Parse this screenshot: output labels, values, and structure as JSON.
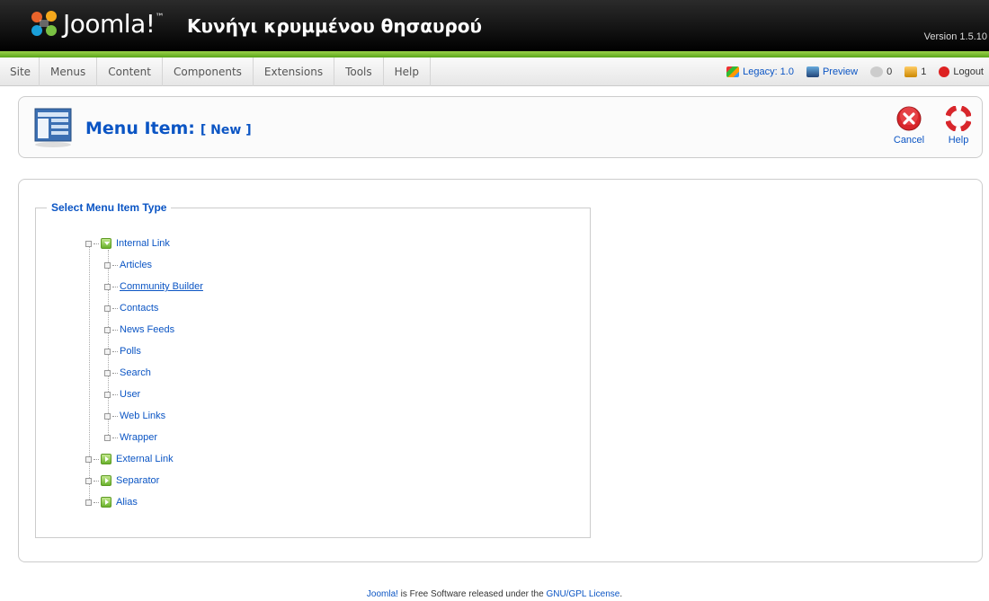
{
  "header": {
    "brand": "Joomla!",
    "brand_tm": "™",
    "site_name": "Κυνήγι κρυμμένου θησαυρού",
    "version": "Version 1.5.10"
  },
  "menu": [
    "Site",
    "Menus",
    "Content",
    "Components",
    "Extensions",
    "Tools",
    "Help"
  ],
  "status": {
    "legacy": "Legacy: 1.0",
    "preview": "Preview",
    "messages": "0",
    "users": "1",
    "logout": "Logout"
  },
  "toolbar": {
    "title": "Menu Item:",
    "subtitle": "[ New ]",
    "cancel": "Cancel",
    "help": "Help"
  },
  "fieldset": {
    "legend": "Select Menu Item Type",
    "internal_link": "Internal Link",
    "children": [
      "Articles",
      "Community Builder",
      "Contacts",
      "News Feeds",
      "Polls",
      "Search",
      "User",
      "Web Links",
      "Wrapper"
    ],
    "external_link": "External Link",
    "separator": "Separator",
    "alias": "Alias"
  },
  "footer": {
    "brand_link": "Joomla!",
    "text": " is Free Software released under the ",
    "license_link": "GNU/GPL License",
    "end": "."
  },
  "colors": {
    "accent": "#0b55c4",
    "header_bg": "#000000",
    "green_bar": "#7cc033"
  }
}
